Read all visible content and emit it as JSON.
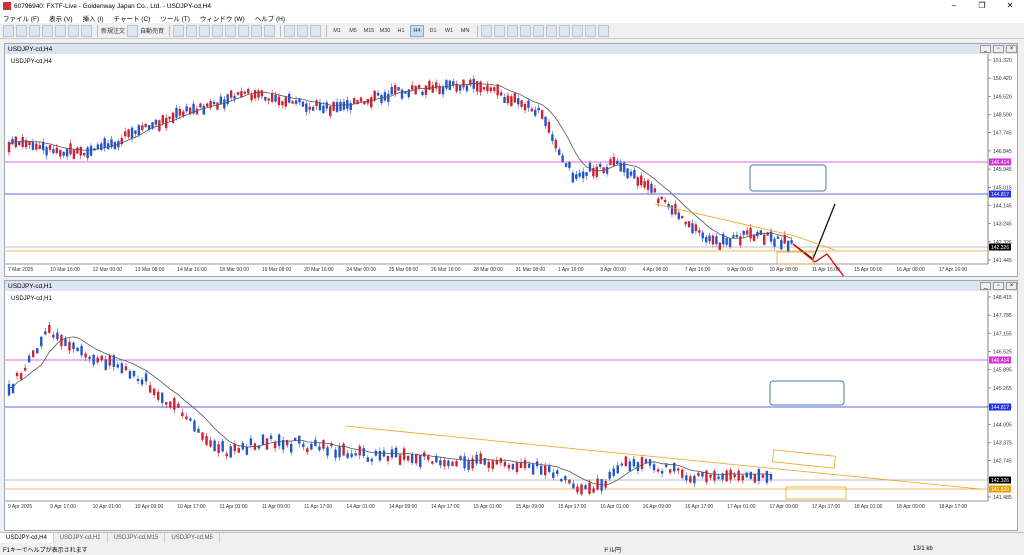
{
  "window": {
    "title": "60796940: FXTF-Live - Goldenway Japan Co., Ltd. - USDJPY-cd,H4"
  },
  "menu": [
    "ファイル (F)",
    "表示 (V)",
    "挿入 (I)",
    "チャート (C)",
    "ツール (T)",
    "ウィンドウ (W)",
    "ヘルプ (H)"
  ],
  "toolbar": {
    "new_order": "新規注文",
    "auto_trade": "自動売買",
    "timeframes": [
      "M1",
      "M5",
      "M15",
      "M30",
      "H1",
      "H4",
      "D1",
      "W1",
      "MN"
    ],
    "active_timeframe": "H4"
  },
  "chart_h4": {
    "window_title": "USDJPY-cd,H4",
    "label": "USDJPY-cd,H4",
    "price_ticks": [
      "151.320",
      "150.420",
      "149.520",
      "148.590",
      "147.745",
      "146.845",
      "145.945",
      "145.015",
      "144.145",
      "143.245",
      "142.326",
      "141.445"
    ],
    "markers": [
      {
        "label": "146.414",
        "color": "#d633d6"
      },
      {
        "label": "144.817",
        "color": "#2233dd"
      },
      {
        "label": "142.326",
        "color": "#000000"
      }
    ],
    "time_labels": [
      "7 Mar 2025",
      "10 Mar 16:00",
      "12 Mar 00:00",
      "13 Mar 08:00",
      "14 Mar 16:00",
      "18 Mar 00:00",
      "19 Mar 08:00",
      "20 Mar 16:00",
      "24 Mar 00:00",
      "25 Mar 08:00",
      "26 Mar 16:00",
      "28 Mar 00:00",
      "31 Mar 08:00",
      "1 Apr 16:00",
      "3 Apr 00:00",
      "4 Apr 08:00",
      "7 Apr 16:00",
      "9 Apr 00:00",
      "10 Apr 08:00",
      "11 Apr 16:00",
      "15 Apr 00:00",
      "16 Apr 08:00",
      "17 Apr 16:00"
    ]
  },
  "chart_h1": {
    "window_title": "USDJPY-cd,H1",
    "label": "USDJPY-cd,H1",
    "price_ticks": [
      "148.415",
      "147.785",
      "147.155",
      "146.525",
      "145.895",
      "145.265",
      "144.635",
      "144.005",
      "143.375",
      "142.745",
      "142.115",
      "141.485"
    ],
    "markers": [
      {
        "label": "146.414",
        "color": "#d633d6"
      },
      {
        "label": "144.817",
        "color": "#2233dd"
      },
      {
        "label": "142.326",
        "color": "#000000"
      },
      {
        "label": "141.820",
        "color": "#e8a000"
      }
    ],
    "time_labels": [
      "9 Apr 2025",
      "9 Apr 17:00",
      "10 Apr 01:00",
      "10 Apr 09:00",
      "10 Apr 17:00",
      "11 Apr 01:00",
      "11 Apr 09:00",
      "11 Apr 17:00",
      "14 Apr 01:00",
      "14 Apr 09:00",
      "14 Apr 17:00",
      "15 Apr 01:00",
      "15 Apr 09:00",
      "15 Apr 17:00",
      "16 Apr 01:00",
      "16 Apr 09:00",
      "16 Apr 17:00",
      "17 Apr 01:00",
      "17 Apr 09:00",
      "17 Apr 17:00",
      "18 Apr 01:00",
      "18 Apr 09:00",
      "18 Apr 17:00"
    ]
  },
  "tabs": [
    "USDJPY-cd,H4",
    "USDJPY-cd,H1",
    "USDJPY-cd,M15",
    "USDJPY-cd,M5"
  ],
  "status": {
    "help": "F1キーでヘルプが表示されます",
    "currency": "ドル円",
    "traffic": "13/1 kb"
  },
  "colors": {
    "bull": "#2255cc",
    "bear": "#cc2233",
    "ma": "#555555",
    "magenta": "#d633d6",
    "blue_line": "#2233dd",
    "orange": "#f0a020"
  }
}
